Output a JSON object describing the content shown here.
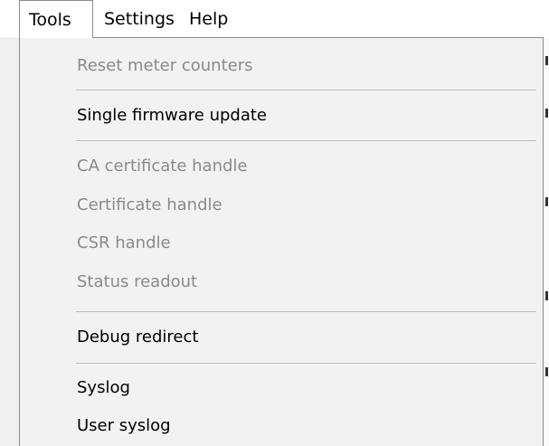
{
  "menubar": {
    "items": [
      {
        "label": "Tools"
      },
      {
        "label": "Settings"
      },
      {
        "label": "Help"
      }
    ]
  },
  "tools_menu": {
    "items": [
      {
        "label": "Reset meter counters",
        "enabled": false
      },
      {
        "label": "Single firmware update",
        "enabled": true
      },
      {
        "label": "CA certificate handle",
        "enabled": false
      },
      {
        "label": "Certificate handle",
        "enabled": false
      },
      {
        "label": "CSR handle",
        "enabled": false
      },
      {
        "label": "Status readout",
        "enabled": false
      },
      {
        "label": "Debug redirect",
        "enabled": true
      },
      {
        "label": "Syslog",
        "enabled": true
      },
      {
        "label": "User syslog",
        "enabled": true
      }
    ]
  }
}
